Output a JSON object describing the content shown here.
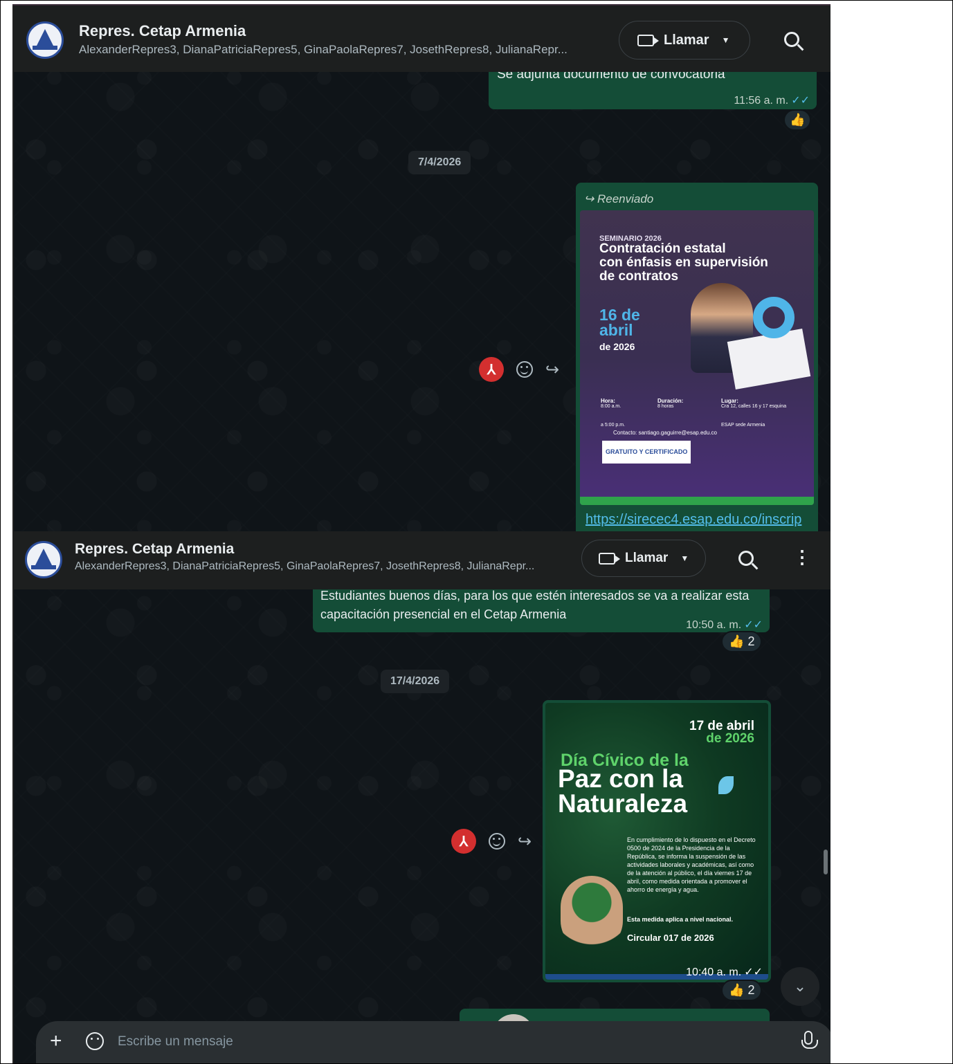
{
  "chat": {
    "title": "Repres. Cetap Armenia",
    "members": "AlexanderRepres3, DianaPatriciaRepres5, GinaPaolaRepres7, JosethRepres8, JulianaRepr...",
    "call_label": "Llamar"
  },
  "panel1": {
    "partial_message": "Se adjunta documento de  convocatoria",
    "partial_time": "11:56 a. m.",
    "date_chip": "7/4/2026",
    "forwarded_label": "Reenviado",
    "poster": {
      "eyebrow": "SEMINARIO 2026",
      "title_line1": "Contratación estatal",
      "title_line2": "con énfasis en supervisión",
      "title_line3": "de contratos",
      "date_big1": "16 de",
      "date_big2": "abril",
      "date_small": "de 2026",
      "hora_label": "Hora:",
      "hora_value": "8:00 a.m.\na 5:00 p.m.",
      "duracion_label": "Duración:",
      "duracion_value": "8 horas",
      "lugar_label": "Lugar:",
      "lugar_value": "Cra 12, calles 16 y 17 esquina\nESAP sede Armenia",
      "contact": "Contacto: santiago.gaguirre@esap.edu.co",
      "badge": "GRATUITO Y CERTIFICADO"
    },
    "link": "https://sirecec4.esap.edu.co/inscrip"
  },
  "panel2": {
    "message": "Estudiantes buenos días, para los que estén interesados se va a realizar esta capacitación presencial en el Cetap Armenia",
    "message_time": "10:50 a. m.",
    "reaction_count": "2",
    "date_chip": "17/4/2026",
    "poster": {
      "date1": "17 de abril",
      "date2": "de 2026",
      "title1": "Día Cívico de la",
      "title2": "Paz con la",
      "title3": "Naturaleza",
      "body": "En cumplimiento de lo dispuesto en el Decreto 0500 de 2024 de la Presidencia de la República, se informa la suspensión de las actividades laborales y académicas, así como de la atención al público, el día viernes 17 de abril, como medida orientada a promover el ahorro de energía y agua.",
      "note": "Esta medida aplica a nivel nacional.",
      "circular": "Circular 017 de 2026"
    },
    "poster_time": "10:40 a. m.",
    "poster_reaction_count": "2"
  },
  "composer": {
    "placeholder": "Escribe un mensaje"
  },
  "colors": {
    "bubble": "#144d37",
    "background": "#0f1418",
    "header": "#1d1f1f",
    "ticks": "#53bdeb"
  }
}
